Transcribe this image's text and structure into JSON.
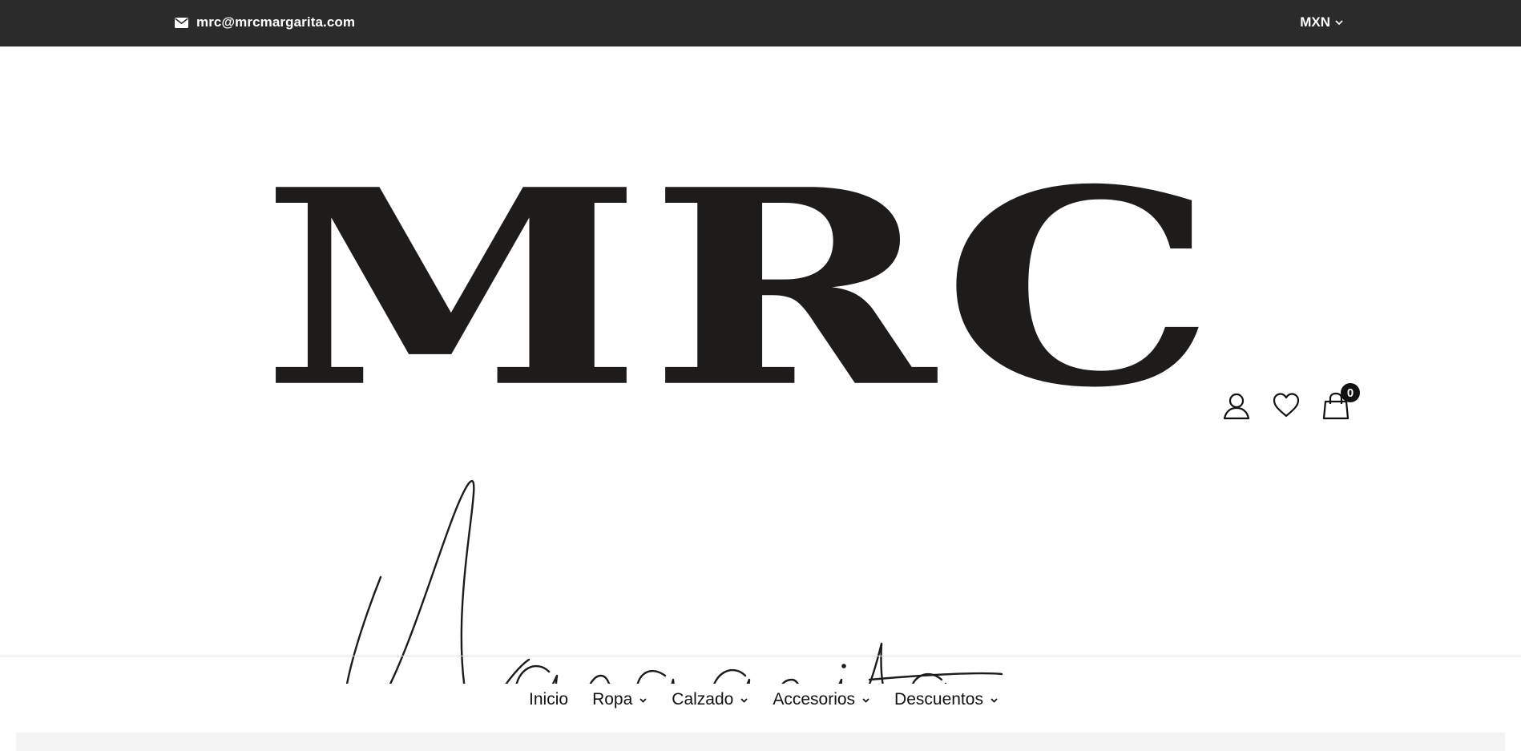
{
  "topbar": {
    "email": "mrc@mrcmargarita.com",
    "email_icon": "envelope-icon",
    "currency": "MXN"
  },
  "logo": {
    "wordmark": "MRC",
    "script": "Margarita"
  },
  "header_icons": {
    "account_icon": "user-icon",
    "wishlist_icon": "heart-icon",
    "cart_icon": "shopping-bag-icon",
    "cart_count": "0"
  },
  "nav": {
    "items": [
      {
        "label": "Inicio",
        "has_dropdown": false
      },
      {
        "label": "Ropa",
        "has_dropdown": true
      },
      {
        "label": "Calzado",
        "has_dropdown": true
      },
      {
        "label": "Accesorios",
        "has_dropdown": true
      },
      {
        "label": "Descuentos",
        "has_dropdown": true
      }
    ]
  },
  "colors": {
    "topbar_bg": "#2b2b2b",
    "logo_ink": "#1e1c1b",
    "badge_bg": "#111111"
  }
}
